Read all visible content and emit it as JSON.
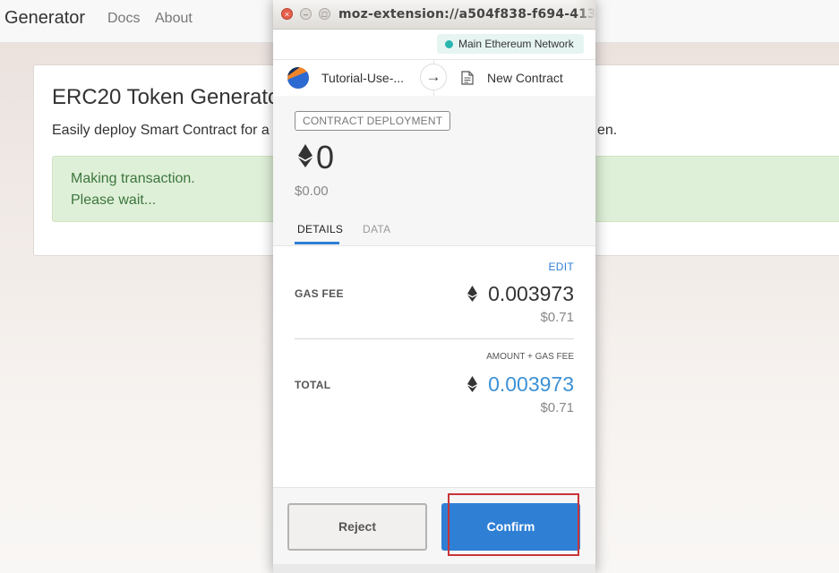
{
  "background_page": {
    "nav": {
      "brand": "Generator",
      "links": [
        "Docs",
        "About"
      ]
    },
    "card": {
      "title": "ERC20 Token Generato",
      "description_left": "Easily deploy Smart Contract for a S",
      "description_right": "en.",
      "alert_line1": "Making transaction.",
      "alert_line2": "Please wait..."
    }
  },
  "popup": {
    "titlebar_url": "moz-extension://a504f838-f694-413d-8",
    "network": {
      "label": "Main Ethereum Network",
      "dot_color": "#29b6af"
    },
    "account": {
      "name": "Tutorial-Use-...",
      "destination": "New Contract"
    },
    "summary": {
      "badge": "CONTRACT DEPLOYMENT",
      "amount": "0",
      "fiat": "$0.00"
    },
    "tabs": [
      {
        "label": "DETAILS",
        "active": true
      },
      {
        "label": "DATA",
        "active": false
      }
    ],
    "details": {
      "edit_label": "EDIT",
      "gas_fee_label": "GAS FEE",
      "gas_fee_eth": "0.003973",
      "gas_fee_fiat": "$0.71",
      "amount_plus_gas_label": "AMOUNT + GAS FEE",
      "total_label": "TOTAL",
      "total_eth": "0.003973",
      "total_fiat": "$0.71"
    },
    "buttons": {
      "reject": "Reject",
      "confirm": "Confirm"
    },
    "colors": {
      "accent": "#2f7fd5",
      "total_value": "#3d91d4",
      "highlight": "#c8343a"
    }
  }
}
